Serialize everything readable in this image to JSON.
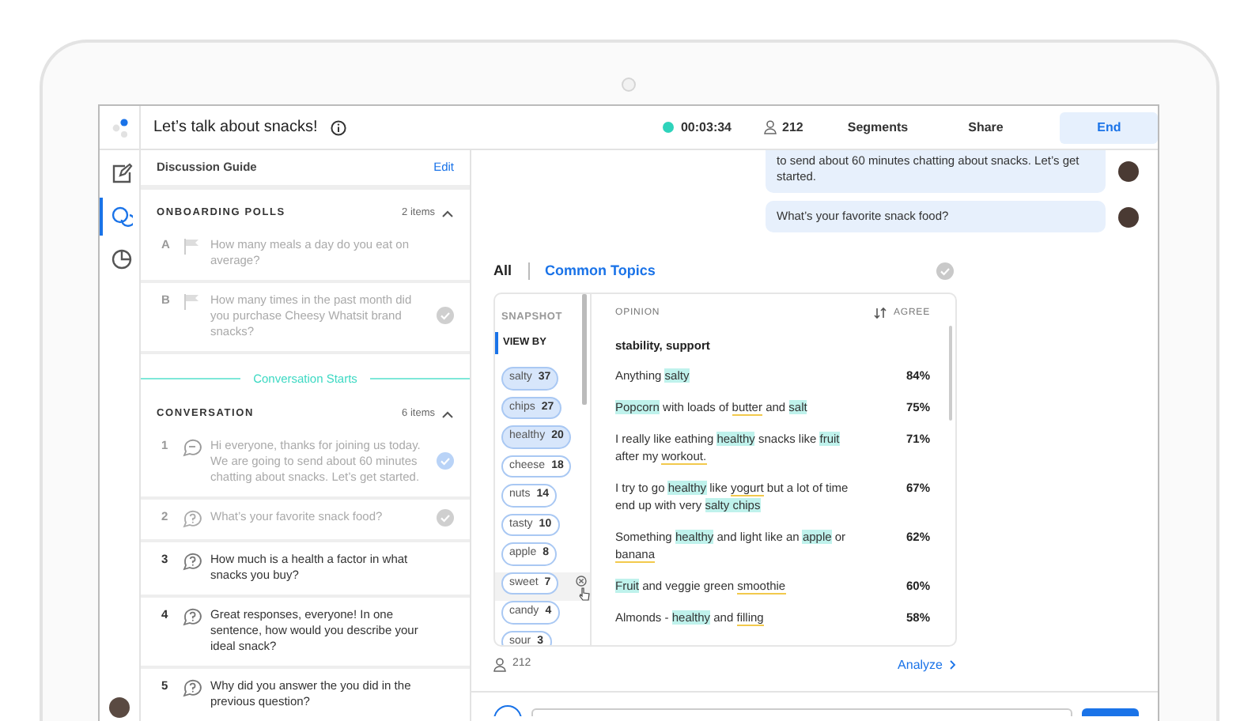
{
  "app": {
    "title": "Let’s talk about snacks!",
    "timer": "00:03:34",
    "participants": "212",
    "actions": [
      {
        "label": "Segments",
        "kind": "link"
      },
      {
        "label": "Share",
        "kind": "link"
      },
      {
        "label": "End",
        "kind": "primary"
      }
    ]
  },
  "rail": [
    {
      "kind": "edit",
      "selected": false
    },
    {
      "kind": "chat",
      "selected": true
    },
    {
      "kind": "chart",
      "selected": false
    }
  ],
  "guide": {
    "title": "Discussion Guide",
    "edit": "Edit",
    "sections": [
      {
        "title": "ONBOARDING POLLS",
        "count": "2 items",
        "expanded": true,
        "items": [
          {
            "marker": "A",
            "kind": "poll",
            "dimmed": true,
            "checked": false,
            "active": false,
            "text": "How many meals a day do you eat on average?"
          },
          {
            "marker": "B",
            "kind": "poll",
            "dimmed": true,
            "checked": true,
            "active": false,
            "text": "How many times in the past month did you purchase Cheesy Whatsit brand snacks?"
          }
        ]
      },
      {
        "starts_label": "Conversation Starts",
        "title": "CONVERSATION",
        "count": "6 items",
        "expanded": true,
        "items": [
          {
            "marker": "1",
            "kind": "message",
            "dimmed": true,
            "checked": true,
            "active": true,
            "text": "Hi everyone, thanks for joining us today. We are going to send about 60 minutes chatting about snacks. Let’s get started."
          },
          {
            "marker": "2",
            "kind": "question",
            "dimmed": true,
            "checked": true,
            "active": false,
            "text": "What’s your favorite snack food?"
          },
          {
            "marker": "3",
            "kind": "question",
            "dimmed": false,
            "checked": false,
            "active": false,
            "text": "How much is a health a factor in what snacks you buy?"
          },
          {
            "marker": "4",
            "kind": "question",
            "dimmed": false,
            "checked": false,
            "active": false,
            "text": "Great responses, everyone! In one sentence, how would you describe your ideal snack?"
          },
          {
            "marker": "5",
            "kind": "question",
            "dimmed": false,
            "checked": false,
            "active": false,
            "text": "Why did you answer the you did in the previous question?"
          }
        ]
      }
    ]
  },
  "messages": [
    {
      "text": "to send about 60 minutes chatting about snacks. Let’s get started."
    },
    {
      "text": "What’s your favorite snack food?"
    }
  ],
  "results": {
    "tabs": [
      {
        "label": "All",
        "selected": false
      },
      {
        "label": "Common Topics",
        "selected": true
      }
    ],
    "snapshot": "SNAPSHOT",
    "view_by": "VIEW BY",
    "chips": [
      {
        "label": "salty",
        "count": "37",
        "selected": true,
        "hovered": false
      },
      {
        "label": "chips",
        "count": "27",
        "selected": true,
        "hovered": false
      },
      {
        "label": "healthy",
        "count": "20",
        "selected": true,
        "hovered": false
      },
      {
        "label": "cheese",
        "count": "18",
        "selected": false,
        "hovered": false
      },
      {
        "label": "nuts",
        "count": "14",
        "selected": false,
        "hovered": false
      },
      {
        "label": "tasty",
        "count": "10",
        "selected": false,
        "hovered": false
      },
      {
        "label": "apple",
        "count": "8",
        "selected": false,
        "hovered": false
      },
      {
        "label": "sweet",
        "count": "7",
        "selected": false,
        "hovered": true
      },
      {
        "label": "candy",
        "count": "4",
        "selected": false,
        "hovered": false
      },
      {
        "label": "sour",
        "count": "3",
        "selected": false,
        "hovered": false
      }
    ],
    "opinion_header": "OPINION",
    "agree_header": "AGREE",
    "group": "stability, support",
    "opinions": [
      {
        "agree": "84%",
        "segments": [
          {
            "text": "Anything ",
            "highlighted": false,
            "underlined": false
          },
          {
            "text": "salty",
            "highlighted": true,
            "underlined": false
          }
        ]
      },
      {
        "agree": "75%",
        "segments": [
          {
            "text": "Popcorn",
            "highlighted": true,
            "underlined": false
          },
          {
            "text": " with loads of ",
            "highlighted": false,
            "underlined": false
          },
          {
            "text": "butter",
            "highlighted": false,
            "underlined": true
          },
          {
            "text": " and ",
            "highlighted": false,
            "underlined": false
          },
          {
            "text": "salt",
            "highlighted": true,
            "underlined": false
          }
        ]
      },
      {
        "agree": "71%",
        "segments": [
          {
            "text": "I really like eathing ",
            "highlighted": false,
            "underlined": false
          },
          {
            "text": "healthy",
            "highlighted": true,
            "underlined": false
          },
          {
            "text": " snacks like ",
            "highlighted": false,
            "underlined": false
          },
          {
            "text": "fruit",
            "highlighted": true,
            "underlined": false
          },
          {
            "text": " after my ",
            "highlighted": false,
            "underlined": false
          },
          {
            "text": "workout.",
            "highlighted": false,
            "underlined": true
          }
        ]
      },
      {
        "agree": "67%",
        "segments": [
          {
            "text": "I try to go ",
            "highlighted": false,
            "underlined": false
          },
          {
            "text": "healthy",
            "highlighted": true,
            "underlined": false
          },
          {
            "text": " like ",
            "highlighted": false,
            "underlined": false
          },
          {
            "text": "yogurt",
            "highlighted": false,
            "underlined": true
          },
          {
            "text": " but a lot of time end up with very ",
            "highlighted": false,
            "underlined": false
          },
          {
            "text": "salty chips",
            "highlighted": true,
            "underlined": false
          }
        ]
      },
      {
        "agree": "62%",
        "segments": [
          {
            "text": "Something ",
            "highlighted": false,
            "underlined": false
          },
          {
            "text": "healthy",
            "highlighted": true,
            "underlined": false
          },
          {
            "text": " and light like an ",
            "highlighted": false,
            "underlined": false
          },
          {
            "text": "apple",
            "highlighted": true,
            "underlined": false
          },
          {
            "text": " or ",
            "highlighted": false,
            "underlined": false
          },
          {
            "text": "banana",
            "highlighted": false,
            "underlined": true
          }
        ]
      },
      {
        "agree": "60%",
        "segments": [
          {
            "text": "Fruit",
            "highlighted": true,
            "underlined": false
          },
          {
            "text": " and veggie green ",
            "highlighted": false,
            "underlined": false
          },
          {
            "text": "smoothie",
            "highlighted": false,
            "underlined": true
          }
        ]
      },
      {
        "agree": "58%",
        "segments": [
          {
            "text": "Almonds - ",
            "highlighted": false,
            "underlined": false
          },
          {
            "text": "healthy",
            "highlighted": true,
            "underlined": false
          },
          {
            "text": " and ",
            "highlighted": false,
            "underlined": false
          },
          {
            "text": "filling",
            "highlighted": false,
            "underlined": true
          }
        ]
      }
    ],
    "respondents": "212",
    "analyze": "Analyze"
  }
}
